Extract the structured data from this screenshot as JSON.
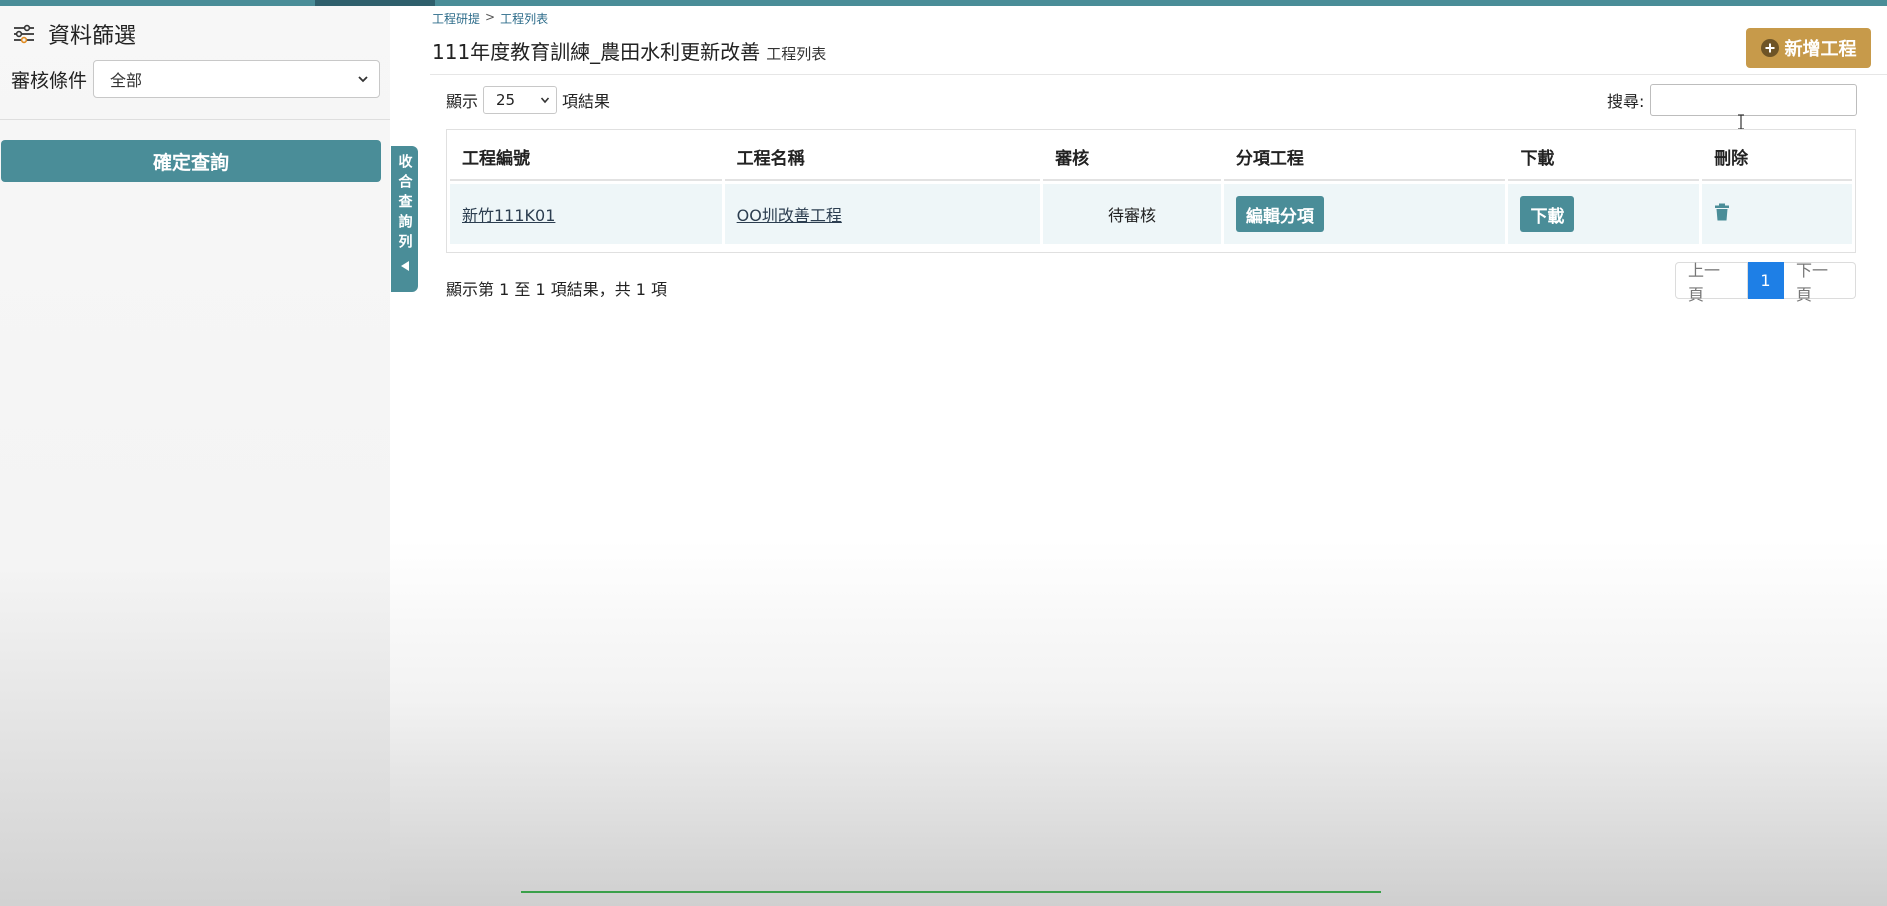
{
  "sidebar": {
    "title": "資料篩選",
    "filter_label": "審核條件",
    "filter_value": "全部",
    "query_button": "確定查詢",
    "collapse_label": "收合查詢列"
  },
  "breadcrumb": {
    "parent": "工程研提",
    "separator": ">",
    "current": "工程列表"
  },
  "page": {
    "title": "111年度教育訓練_農田水利更新改善",
    "subtitle": "工程列表",
    "add_button": "新增工程"
  },
  "table_controls": {
    "show_prefix": "顯示",
    "page_length": "25",
    "show_suffix": "項結果",
    "search_label": "搜尋:",
    "search_value": ""
  },
  "table": {
    "headers": [
      "工程編號",
      "工程名稱",
      "審核",
      "分項工程",
      "下載",
      "刪除"
    ],
    "rows": [
      {
        "id": "新竹111K01",
        "name": "OO圳改善工程",
        "status": "待審核",
        "edit_label": "編輯分項",
        "download_label": "下載"
      }
    ]
  },
  "info_text": "顯示第 1 至 1 項結果，共 1 項",
  "pagination": {
    "prev": "上一頁",
    "current": "1",
    "next": "下一頁"
  },
  "colors": {
    "accent": "#4a8d98",
    "add_button": "#c79a4a",
    "active_page": "#1e7fe6"
  }
}
